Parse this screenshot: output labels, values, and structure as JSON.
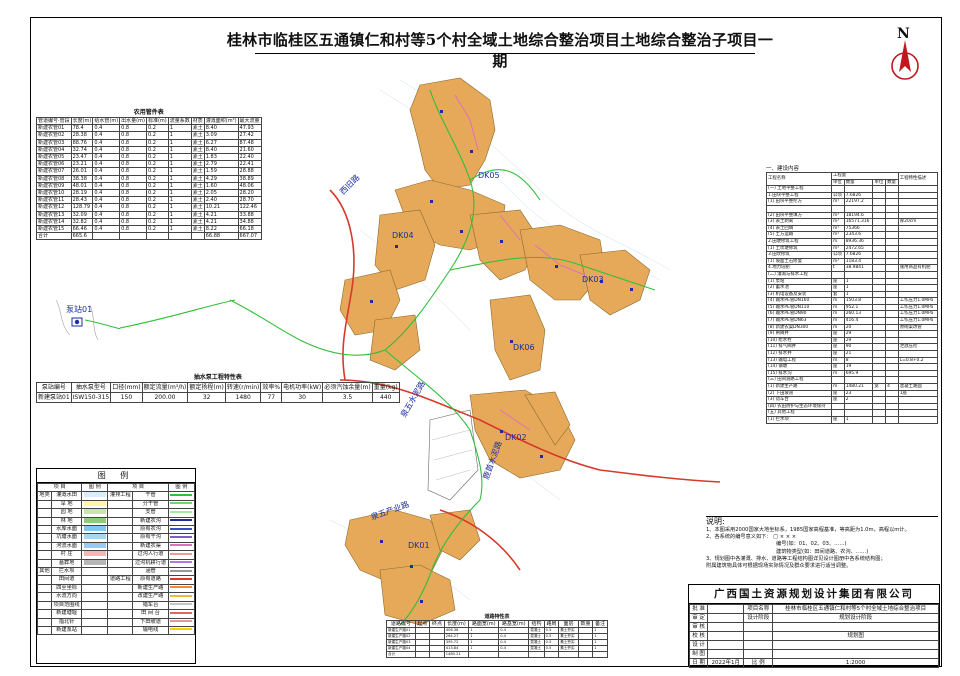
{
  "title": "桂林市临桂区五通镇仁和村等5个村全域土地综合整治项目土地综合整治子项目一期",
  "north": {
    "letter": "N",
    "icon": "north-arrow-icon"
  },
  "map_labels": {
    "pump_station": "泵站01",
    "road1": "西旧路",
    "road2": "泉五水泥路",
    "road3": "鹿首水泥路",
    "road4": "泉五产业路",
    "zones": [
      "DK05",
      "DK04",
      "DK03",
      "DK06",
      "DK02",
      "DK01"
    ]
  },
  "colors": {
    "parcel_fill": "#e6a95a",
    "road_red": "#d63a2a",
    "water_green": "#2fbf3a",
    "pipe_blue": "#1b2d9c",
    "channel_pink": "#e070b8"
  },
  "pipe_table": {
    "title": "农用管件表",
    "headers": [
      "管道编号·管段",
      "长度(m)",
      "给水管(m)",
      "出水量(m)",
      "标准(m)",
      "流量系数",
      "材质",
      "灌溉面积(m²)",
      "最大流量"
    ],
    "rows": [
      [
        "新建农管01",
        "78.4",
        "0.4",
        "0.8",
        "0.2",
        "1",
        "素土",
        "8.40",
        "47.93"
      ],
      [
        "新建农管02",
        "28.38",
        "0.4",
        "0.8",
        "0.2",
        "1",
        "素土",
        "3.09",
        "27.42"
      ],
      [
        "新建农管03",
        "88.76",
        "0.4",
        "0.8",
        "0.2",
        "1",
        "素土",
        "6.27",
        "87.48"
      ],
      [
        "新建农管04",
        "32.74",
        "0.4",
        "0.8",
        "0.2",
        "1",
        "素土",
        "8.40",
        "21.60"
      ],
      [
        "新建农管05",
        "23.47",
        "0.4",
        "0.8",
        "0.2",
        "1",
        "素土",
        "1.83",
        "22.40"
      ],
      [
        "新建农管06",
        "23.21",
        "0.4",
        "0.8",
        "0.2",
        "1",
        "素土",
        "2.79",
        "22.41"
      ],
      [
        "新建农管07",
        "26.01",
        "0.4",
        "0.8",
        "0.2",
        "1",
        "素土",
        "1.59",
        "28.88"
      ],
      [
        "新建农管08",
        "38.38",
        "0.4",
        "0.8",
        "0.2",
        "1",
        "素土",
        "4.29",
        "38.89"
      ],
      [
        "新建农管09",
        "48.01",
        "0.4",
        "0.8",
        "0.2",
        "1",
        "素土",
        "1.60",
        "48.06"
      ],
      [
        "新建农管10",
        "28.19",
        "0.4",
        "0.8",
        "0.2",
        "1",
        "素土",
        "2.05",
        "28.20"
      ],
      [
        "新建农管11",
        "28.43",
        "0.4",
        "0.8",
        "0.2",
        "1",
        "素土",
        "2.40",
        "28.70"
      ],
      [
        "新建农管12",
        "128.79",
        "0.4",
        "0.8",
        "0.2",
        "1",
        "素土",
        "10.21",
        "122.46"
      ],
      [
        "新建农管13",
        "32.09",
        "0.4",
        "0.8",
        "0.2",
        "1",
        "素土",
        "4.21",
        "33.88"
      ],
      [
        "新建农管14",
        "32.82",
        "0.4",
        "0.8",
        "0.2",
        "1",
        "素土",
        "4.21",
        "34.88"
      ],
      [
        "新建农管15",
        "66.46",
        "0.4",
        "0.8",
        "0.2",
        "1",
        "素土",
        "8.22",
        "66.18"
      ],
      [
        "合计",
        "665.6",
        "",
        "",
        "",
        "",
        "",
        "66.88",
        "667.07"
      ]
    ]
  },
  "pump_table": {
    "title": "抽水泵工程特性表",
    "headers": [
      "泵站编号",
      "抽水泵型号",
      "口径(mm)",
      "额定流量(m³/h)",
      "额定扬程(m)",
      "转速(r/min)",
      "效率%",
      "电机功率(kW)",
      "必须汽蚀余量(m)",
      "重量(kg)"
    ],
    "rows": [
      [
        "新建泵站01",
        "ISW150-315",
        "150",
        "200.00",
        "32",
        "1480",
        "77",
        "30",
        "3.5",
        "440"
      ]
    ]
  },
  "legend": {
    "title": "图 例",
    "headers": [
      "项 目",
      "图 例",
      "项 目",
      "图 例"
    ],
    "left_group": "地类",
    "left_items": [
      "灌溉水田",
      "旱 地",
      "园 地",
      "林 地",
      "水库水面",
      "坑塘水面",
      "河流水面",
      "村 庄",
      "墓葬地"
    ],
    "left_misc": [
      "拦水坝",
      "田间道",
      "四至坐标"
    ],
    "left_misc_group": "其他",
    "left_misc2": [
      "水流方向",
      "项目范围线",
      "新建塘堰",
      "指北针",
      "新建泵站"
    ],
    "right_group_irr": "灌排工程",
    "right_items_irr": [
      "干管",
      "分干管",
      "支管",
      "新建农沟",
      "原有农沟",
      "原有干沟",
      "新建农渠",
      "过沟人行道",
      "过沟机耕行道",
      "涵管"
    ],
    "right_group_road": "道路工程",
    "right_items_road": [
      "原有道路",
      "新建生产路",
      "改建生产路",
      "错车台",
      "田 间 台",
      "下田坡道",
      "输电线"
    ],
    "pump_label": "泵站01",
    "weir_label": "1 拦水坝"
  },
  "qty_table": {
    "title": "一、建设内容",
    "headers": [
      "工程名称",
      "单位",
      "数量",
      "单位",
      "数量",
      "工程特性描述"
    ],
    "subheader": "工程量",
    "rows": [
      [
        "(一) 土地平整工程",
        "",
        "",
        "",
        "",
        ""
      ],
      [
        "1.田块平整工程",
        "公顷",
        "7.6826",
        "",
        "",
        ""
      ],
      [
        "(1) 田块平整挖方",
        "m³",
        "22197.2",
        "",
        "",
        ""
      ],
      [
        "",
        "",
        "",
        "",
        "",
        ""
      ],
      [
        "(2) 田块平整填方",
        "m³",
        "18194.6",
        "",
        "",
        ""
      ],
      [
        "(3) 表土剥离",
        "m³",
        "16571.316",
        "",
        "",
        "厚20cm"
      ],
      [
        "(4) 表土回填",
        "m³",
        "75366",
        "",
        "",
        ""
      ],
      [
        "(5) 土方运输",
        "m³",
        "2343.6",
        "",
        "",
        ""
      ],
      [
        "2.田埂修筑工程",
        "m",
        "8936.36",
        "",
        "",
        ""
      ],
      [
        "(1) 土坎埂修筑",
        "m³",
        "2472.65",
        "",
        "",
        ""
      ],
      [
        "3.田坎修筑",
        "公顷",
        "7.6826",
        "",
        "",
        ""
      ],
      [
        "(1) 坡面土石修复",
        "m³",
        "1183.4",
        "",
        "",
        ""
      ],
      [
        "4.地力培肥",
        "t",
        "38.9841",
        "",
        "",
        "施用商品有机肥"
      ],
      [
        "(二) 灌溉与排水工程",
        "",
        "",
        "",
        "",
        ""
      ],
      [
        "(1) 泵站",
        "座",
        "1",
        "",
        "",
        ""
      ],
      [
        "(2) 蓄水池",
        "座",
        "1",
        "",
        "",
        ""
      ],
      [
        "(3) 机电设备及安装",
        "套",
        "1",
        "",
        "",
        ""
      ],
      [
        "(4) 输水PE管DN160",
        "m",
        "1503.8",
        "",
        "",
        "工作压力1.0MPa"
      ],
      [
        "(5) 输水PE管DN110",
        "m",
        "952.1",
        "",
        "",
        "工作压力1.0MPa"
      ],
      [
        "(6) 输水PE管DN90",
        "m",
        "260.13",
        "",
        "",
        "工作压力1.0MPa"
      ],
      [
        "(7) 输水PE管DN63",
        "m",
        "416.4",
        "",
        "",
        "工作压力1.0MPa"
      ],
      [
        "(8) 新建农渠DN300",
        "m",
        "20",
        "",
        "",
        "原砌渠改管"
      ],
      [
        "(9) 闸阀井",
        "座",
        "29",
        "",
        "",
        ""
      ],
      [
        "(10) 给水栓",
        "座",
        "29",
        "",
        "",
        ""
      ],
      [
        "(11) 排气阀井",
        "座",
        "90",
        "",
        "",
        "泄放压检"
      ],
      [
        "(12) 排水井",
        "座",
        "21",
        "",
        "",
        ""
      ],
      [
        "(13) 输电工程",
        "m",
        "8",
        "",
        "",
        "L=0.8+0.2"
      ],
      [
        "(14) 镇墩",
        "座",
        "19",
        "",
        "",
        ""
      ],
      [
        "(15) 排水沟",
        "m",
        "695.9",
        "",
        "",
        ""
      ],
      [
        "(三) 田间道路工程",
        "",
        "",
        "",
        "",
        ""
      ],
      [
        "(1) 新建生产路",
        "m",
        "1480.21",
        "宽",
        "4",
        "混凝土路面"
      ],
      [
        "(2) 下田坡道",
        "座",
        "23",
        "",
        "",
        "1座"
      ],
      [
        "(3) 错车台",
        "座",
        "2",
        "",
        "",
        ""
      ],
      [
        "(四) 农田防护与生态环境保持",
        "",
        "",
        "",
        "",
        ""
      ],
      [
        "(五) 其他工程",
        "",
        "",
        "",
        "",
        ""
      ],
      [
        "(1) 拦水坝",
        "座",
        "1",
        "",
        "",
        ""
      ]
    ]
  },
  "notes": {
    "heading": "说明:",
    "lines": [
      "1、本图采用2000国家大地坐标系，1985国家高程基准，等高距为1.0m，高程以m计。",
      "2、各系统的编号意义如下：",
      "3、规划图中各灌溉、排水、道路等工程结构图详见设计图册中各系统结构图；",
      "附属建筑物具体可根据现场实际情况及群众要求进行适当调整。"
    ],
    "code_sample": "□ × × ×",
    "code_legend_a": "编号(如：01、02、03、……)",
    "code_legend_b": "建筑物类型(如：田间道路、农沟、……)"
  },
  "title_block": {
    "company": "广西国土资源规划设计集团有限公司",
    "rows": [
      [
        "批 准",
        "",
        "项目名称",
        "桂林市临桂区五通镇仁和村等5个村全域土地综合整治项目"
      ],
      [
        "审 定",
        "",
        "设计阶段",
        "规划设计阶段"
      ],
      [
        "审 核",
        "",
        "",
        ""
      ],
      [
        "校 核",
        "",
        "",
        "规划图"
      ],
      [
        "设 计",
        "",
        "",
        ""
      ],
      [
        "制 图",
        "",
        "",
        ""
      ],
      [
        "日 期",
        "2022年1月",
        "比 例",
        "1:2000"
      ]
    ]
  },
  "bottom_table": {
    "title": "道路特性表",
    "headers": [
      "道路编号",
      "起点",
      "终点",
      "长度(m)",
      "路面宽(m)",
      "路基宽(m)",
      "结构",
      "路肩",
      "面层",
      "数量",
      "备注"
    ],
    "rows": [
      [
        "新建生产路01",
        "",
        "",
        "406.38",
        "1",
        "0.4",
        "混凝土",
        "0.5",
        "素土夯实",
        "",
        "1"
      ],
      [
        "新建生产路02",
        "",
        "",
        "264.27",
        "1",
        "0.4",
        "混凝土",
        "0.5",
        "素土夯实",
        "",
        "1"
      ],
      [
        "新建生产路03",
        "",
        "",
        "395.72",
        "1",
        "0.4",
        "混凝土",
        "0.5",
        "素土夯实",
        "",
        "1"
      ],
      [
        "新建生产路04",
        "",
        "",
        "413.84",
        "1",
        "0.4",
        "混凝土",
        "0.5",
        "素土夯实",
        "",
        "1"
      ],
      [
        "合计",
        "",
        "",
        "1480.21",
        "",
        "",
        "",
        "",
        "",
        "",
        ""
      ]
    ]
  }
}
